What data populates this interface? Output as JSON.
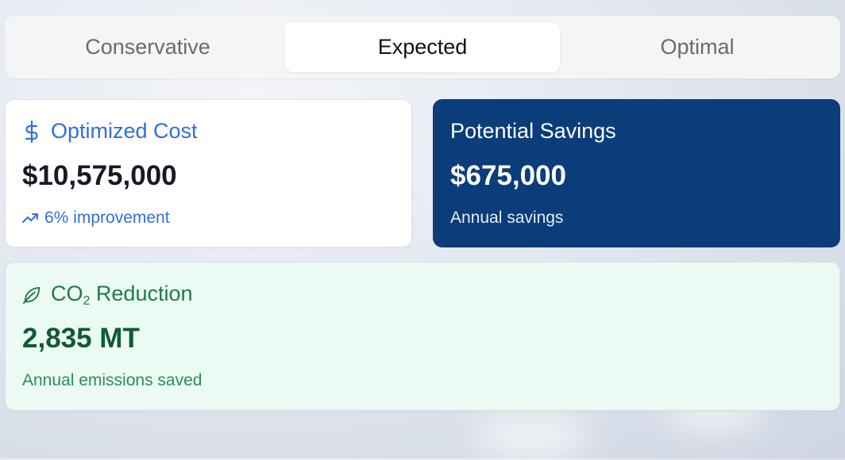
{
  "scenario_tabs": [
    {
      "label": "Conservative",
      "selected": false
    },
    {
      "label": "Expected",
      "selected": true
    },
    {
      "label": "Optimal",
      "selected": false
    }
  ],
  "cost_card": {
    "icon": "dollar-icon",
    "title": "Optimized Cost",
    "value": "$10,575,000",
    "trend_icon": "trending-up-icon",
    "subtitle": "6% improvement",
    "accent_color": "#2f6fdb"
  },
  "savings_card": {
    "title": "Potential Savings",
    "value": "$675,000",
    "subtitle": "Annual savings",
    "background_color": "#0a3d7a"
  },
  "co2_card": {
    "icon": "leaf-icon",
    "title_prefix": "CO",
    "title_subscript": "2",
    "title_suffix": " Reduction",
    "value": "2,835 MT",
    "subtitle": "Annual emissions saved",
    "background_color": "#ebfaf2",
    "accent_color": "#1e7a4c"
  }
}
